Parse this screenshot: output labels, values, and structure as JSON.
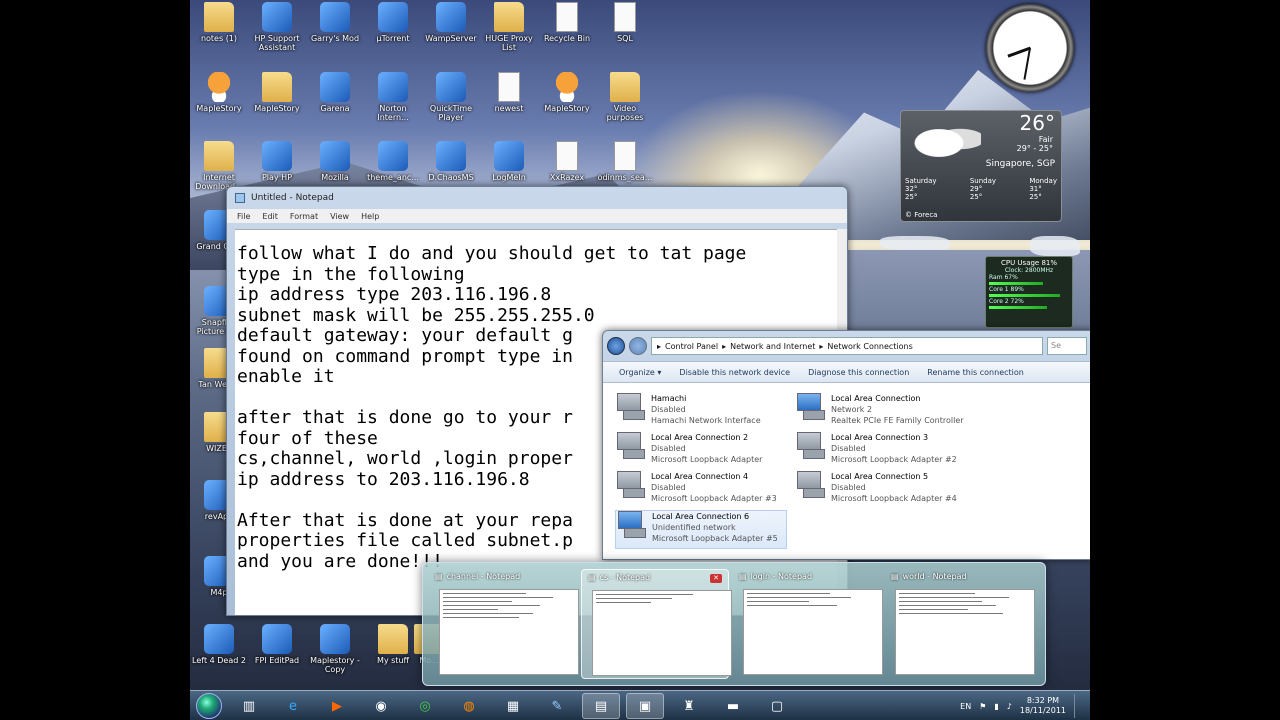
{
  "desktop_icons": [
    {
      "label": "notes (1)"
    },
    {
      "label": "HP Support Assistant"
    },
    {
      "label": "Garry's Mod"
    },
    {
      "label": "µTorrent"
    },
    {
      "label": "WampServer"
    },
    {
      "label": "HUGE Proxy List"
    },
    {
      "label": "Recycle Bin"
    },
    {
      "label": "SQL"
    },
    {
      "label": "MapleStory"
    },
    {
      "label": "MapleStory"
    },
    {
      "label": "Garena"
    },
    {
      "label": "Norton Intern..."
    },
    {
      "label": "QuickTime Player"
    },
    {
      "label": "newest"
    },
    {
      "label": "MapleStory"
    },
    {
      "label": "Video purposes"
    },
    {
      "label": "Internet Download..."
    },
    {
      "label": "Play HP"
    },
    {
      "label": "Mozilla"
    },
    {
      "label": "theme_anc..."
    },
    {
      "label": "D.ChaosMS"
    },
    {
      "label": "LogMeIn"
    },
    {
      "label": "XxRazex"
    },
    {
      "label": "odinms_sea..."
    },
    {
      "label": "Grand Ch..."
    },
    {
      "label": "Snapfish Picture M..."
    },
    {
      "label": "Tan Wen..."
    },
    {
      "label": "WIZET"
    },
    {
      "label": "revApp"
    },
    {
      "label": "M4p"
    },
    {
      "label": "Left 4 Dead 2"
    },
    {
      "label": "FPI EditPad"
    },
    {
      "label": "Maplestory - Copy"
    },
    {
      "label": "My stuff"
    },
    {
      "label": "Mo..."
    }
  ],
  "weather": {
    "temp": "26°",
    "condition": "Fair",
    "range": "29° - 25°",
    "location": "Singapore, SGP",
    "days": [
      {
        "day": "Saturday",
        "hi": "32°",
        "lo": "25°"
      },
      {
        "day": "Sunday",
        "hi": "29°",
        "lo": "25°"
      },
      {
        "day": "Monday",
        "hi": "31°",
        "lo": "25°"
      }
    ],
    "source": "© Foreca"
  },
  "cpu": {
    "title": "CPU Usage 81%",
    "clock": "Clock: 2800MHz",
    "core1": "Core 1 89%",
    "core2": "Core 2 72%",
    "ram": "Ram 67%"
  },
  "notepad": {
    "title": "Untitled - Notepad",
    "menu": [
      "File",
      "Edit",
      "Format",
      "View",
      "Help"
    ],
    "text": "follow what I do and you should get to tat page\ntype in the following\nip address type 203.116.196.8\nsubnet mask will be 255.255.255.0\ndefault gateway: your default g\nfound on command prompt type in\nenable it\n\nafter that is done go to your r\nfour of these\ncs,channel, world ,login proper\nip address to 203.116.196.8\n\nAfter that is done at your repa\nproperties file called subnet.p\nand you are done!!!"
  },
  "explorer": {
    "breadcrumb": [
      "Control Panel",
      "Network and Internet",
      "Network Connections"
    ],
    "search_placeholder": "Se",
    "toolbar": [
      "Organize ▾",
      "Disable this network device",
      "Diagnose this connection",
      "Rename this connection"
    ],
    "connections": [
      {
        "name": "Hamachi",
        "status": "Disabled",
        "adapter": "Hamachi Network Interface",
        "on": false
      },
      {
        "name": "Local Area Connection",
        "status": "Network 2",
        "adapter": "Realtek PCIe FE Family Controller",
        "on": true
      },
      {
        "name": "Local Area Connection 2",
        "status": "Disabled",
        "adapter": "Microsoft Loopback Adapter",
        "on": false
      },
      {
        "name": "Local Area Connection 3",
        "status": "Disabled",
        "adapter": "Microsoft Loopback Adapter #2",
        "on": false
      },
      {
        "name": "Local Area Connection 4",
        "status": "Disabled",
        "adapter": "Microsoft Loopback Adapter #3",
        "on": false
      },
      {
        "name": "Local Area Connection 5",
        "status": "Disabled",
        "adapter": "Microsoft Loopback Adapter #4",
        "on": false
      },
      {
        "name": "Local Area Connection 6",
        "status": "Unidentified network",
        "adapter": "Microsoft Loopback Adapter #5",
        "on": true
      }
    ]
  },
  "thumbnails": [
    {
      "title": "channel - Notepad"
    },
    {
      "title": "cs - Notepad"
    },
    {
      "title": "login - Notepad"
    },
    {
      "title": "world - Notepad"
    }
  ],
  "tray": {
    "lang": "EN",
    "time": "8:32 PM",
    "date": "18/11/2011"
  },
  "colors": {
    "accent": "#1e395b",
    "taskbar": "#2a4560"
  }
}
